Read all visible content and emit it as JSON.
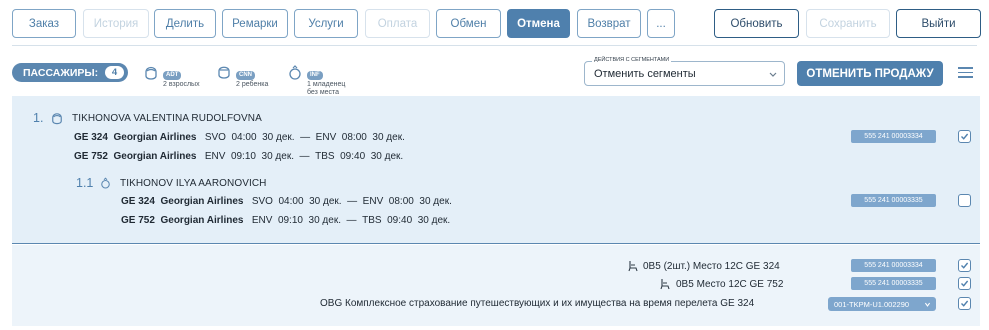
{
  "toolbar": {
    "tabs": [
      {
        "label": "Заказ",
        "state": "normal"
      },
      {
        "label": "История",
        "state": "disabled"
      },
      {
        "label": "Делить",
        "state": "normal"
      },
      {
        "label": "Ремарки",
        "state": "normal"
      },
      {
        "label": "Услуги",
        "state": "normal"
      },
      {
        "label": "Оплата",
        "state": "disabled"
      },
      {
        "label": "Обмен",
        "state": "normal"
      },
      {
        "label": "Отмена",
        "state": "active"
      },
      {
        "label": "Возврат",
        "state": "normal"
      },
      {
        "label": "...",
        "state": "normal"
      }
    ],
    "refresh_label": "Обновить",
    "save_label": "Сохранить",
    "exit_label": "Выйти"
  },
  "passengers": {
    "label": "ПАССАЖИРЫ:",
    "count": "4",
    "types": [
      {
        "badge": "ADT",
        "desc": "2 взрослых",
        "desc2": ""
      },
      {
        "badge": "CNN",
        "desc": "2 ребенка",
        "desc2": ""
      },
      {
        "badge": "INF",
        "desc": "1 младенец",
        "desc2": "без места"
      }
    ]
  },
  "segment_action": {
    "legend": "Действия с сегментами",
    "value": "Отменить сегменты"
  },
  "cancel_sale_label": "ОТМЕНИТЬ ПРОДАЖУ",
  "main_passenger": {
    "num": "1.",
    "name": "TIKHONOVA VALENTINA RUDOLFOVNA",
    "ticket": "555 241 00003334",
    "checked": true,
    "flights": [
      {
        "flight": "GE 324",
        "airline": "Georgian Airlines",
        "from": "SVO",
        "dep": "04:00",
        "dep_date": "30 дек.",
        "dash": "—",
        "to": "ENV",
        "arr": "08:00",
        "arr_date": "30 дек."
      },
      {
        "flight": "GE 752",
        "airline": "Georgian Airlines",
        "from": "ENV",
        "dep": "09:10",
        "dep_date": "30 дек.",
        "dash": "—",
        "to": "TBS",
        "arr": "09:40",
        "arr_date": "30 дек."
      }
    ]
  },
  "infant": {
    "num": "1.1",
    "name": "TIKHONOV ILYA AARONOVICH",
    "ticket": "555 241 00003335",
    "checked": false,
    "flights": [
      {
        "flight": "GE 324",
        "airline": "Georgian Airlines",
        "from": "SVO",
        "dep": "04:00",
        "dep_date": "30 дек.",
        "dash": "—",
        "to": "ENV",
        "arr": "08:00",
        "arr_date": "30 дек."
      },
      {
        "flight": "GE 752",
        "airline": "Georgian Airlines",
        "from": "ENV",
        "dep": "09:10",
        "dep_date": "30 дек.",
        "dash": "—",
        "to": "TBS",
        "arr": "09:40",
        "arr_date": "30 дек."
      }
    ]
  },
  "services": [
    {
      "icon": "seat-icon",
      "text": "0B5 (2шт.)  Место  12C  GE 324",
      "ticket": "555 241 00003334",
      "checked": true
    },
    {
      "icon": "seat-icon",
      "text": "0B5  Место  12C  GE 752",
      "ticket": "555 241 00003335",
      "checked": true
    },
    {
      "icon": "",
      "text": "OBG  Комплексное страхование путешествующих и их имущества на время перелета  GE 324",
      "ticket": "001-TKPM-U1.002290",
      "checked": true
    }
  ]
}
